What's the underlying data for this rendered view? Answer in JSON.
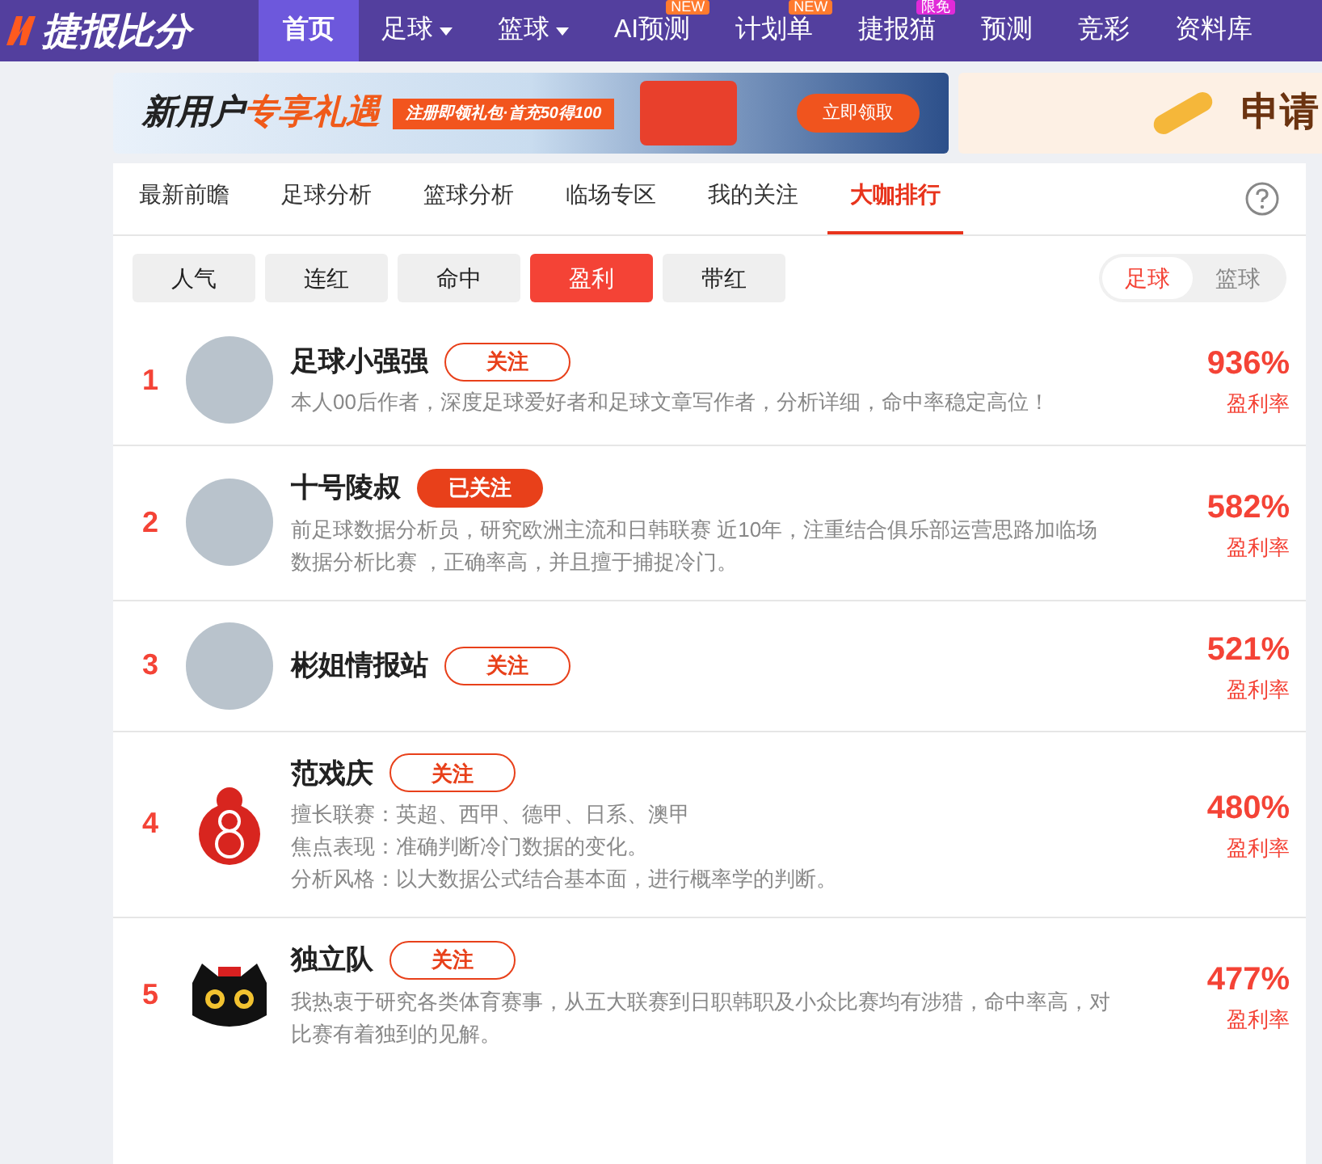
{
  "nav": {
    "logo": "捷报比分",
    "items": [
      {
        "label": "首页",
        "selected": true,
        "dropdown": false
      },
      {
        "label": "足球",
        "selected": false,
        "dropdown": true
      },
      {
        "label": "篮球",
        "selected": false,
        "dropdown": true
      },
      {
        "label": "AI预测",
        "selected": false,
        "dropdown": false,
        "badge": "NEW",
        "color": "#ff7a2e"
      },
      {
        "label": "计划单",
        "selected": false,
        "dropdown": false,
        "badge": "NEW",
        "color": "#ff7a2e"
      },
      {
        "label": "捷报猫",
        "selected": false,
        "dropdown": false,
        "badge": "限免",
        "color": "#e02ad8"
      },
      {
        "label": "预测",
        "selected": false,
        "dropdown": false
      },
      {
        "label": "竞彩",
        "selected": false,
        "dropdown": false
      },
      {
        "label": "资料库",
        "selected": false,
        "dropdown": false
      }
    ]
  },
  "banners": {
    "main": {
      "title_a": "新用户",
      "title_b": "专享礼遇",
      "offer": "注册即领礼包·首充50得100",
      "cta": "立即领取"
    },
    "side": {
      "title": "申请"
    }
  },
  "tabs": [
    {
      "label": "最新前瞻",
      "selected": false
    },
    {
      "label": "足球分析",
      "selected": false
    },
    {
      "label": "篮球分析",
      "selected": false
    },
    {
      "label": "临场专区",
      "selected": false
    },
    {
      "label": "我的关注",
      "selected": false
    },
    {
      "label": "大咖排行",
      "selected": true
    }
  ],
  "filters": [
    {
      "label": "人气",
      "selected": false
    },
    {
      "label": "连红",
      "selected": false
    },
    {
      "label": "命中",
      "selected": false
    },
    {
      "label": "盈利",
      "selected": true
    },
    {
      "label": "带红",
      "selected": false
    }
  ],
  "sport_toggle": [
    {
      "label": "足球",
      "selected": true
    },
    {
      "label": "篮球",
      "selected": false
    }
  ],
  "rankings": [
    {
      "rank": "1",
      "kind": "photo",
      "name": "足球小强强",
      "follow": "关注",
      "followed": false,
      "description": [
        "本人00后作者，深度足球爱好者和足球文章写作者，分析详细，命中率稳定高位！"
      ],
      "rate": "936%",
      "rate_label": "盈利率"
    },
    {
      "rank": "2",
      "kind": "photo",
      "name": "十号陵叔",
      "follow": "已关注",
      "followed": true,
      "description": [
        "前足球数据分析员，研究欧洲主流和日韩联赛 近10年，注重结合俱乐部运营思路加临场数据分析比赛 ，正确率高，并且擅于捕捉冷门。"
      ],
      "rate": "582%",
      "rate_label": "盈利率"
    },
    {
      "rank": "3",
      "kind": "photo",
      "name": "彬姐情报站",
      "follow": "关注",
      "followed": false,
      "rate": "521%",
      "rate_label": "盈利率"
    },
    {
      "rank": "4",
      "kind": "logo",
      "name": "范戏庆",
      "follow": "关注",
      "followed": false,
      "description": [
        "擅长联赛：英超、西甲、德甲、日系、澳甲",
        "焦点表现：准确判断冷门数据的变化。",
        "分析风格：以大数据公式结合基本面，进行概率学的判断。"
      ],
      "rate": "480%",
      "rate_label": "盈利率"
    },
    {
      "rank": "5",
      "kind": "cartoon",
      "name": "独立队",
      "follow": "关注",
      "followed": false,
      "description": [
        "我热衷于研究各类体育赛事，从五大联赛到日职韩职及小众比赛均有涉猎，命中率高，对比赛有着独到的见解。"
      ],
      "rate": "477%",
      "rate_label": "盈利率"
    }
  ]
}
